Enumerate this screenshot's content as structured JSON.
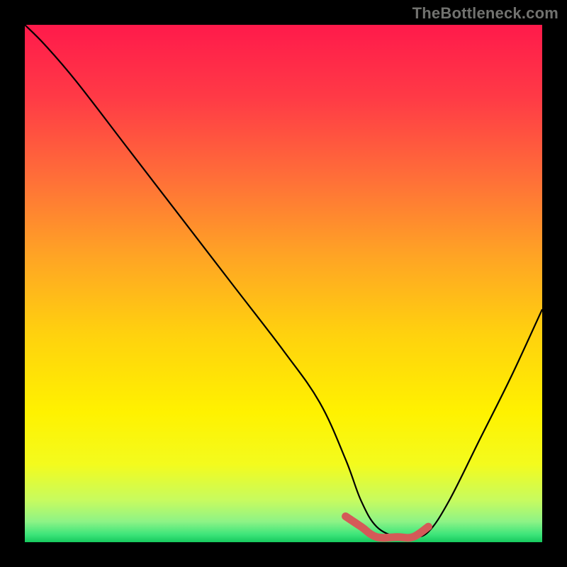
{
  "attribution": "TheBottleneck.com",
  "chart_data": {
    "type": "line",
    "title": "",
    "xlabel": "",
    "ylabel": "",
    "xlim": [
      0,
      100
    ],
    "ylim": [
      0,
      100
    ],
    "series": [
      {
        "name": "bottleneck-curve",
        "x": [
          0,
          4,
          10,
          20,
          30,
          40,
          50,
          57,
          62,
          65,
          68,
          72,
          75,
          78,
          82,
          88,
          94,
          100
        ],
        "values": [
          100,
          96,
          89,
          76,
          63,
          50,
          37,
          27,
          16,
          8,
          3,
          1,
          1,
          2,
          8,
          20,
          32,
          45
        ]
      }
    ],
    "highlight": {
      "name": "optimal-range",
      "x": [
        62,
        65,
        68,
        72,
        75,
        78
      ],
      "values": [
        5,
        3,
        1,
        1,
        1,
        3
      ]
    },
    "background_gradient": {
      "stops": [
        {
          "offset": 0.0,
          "color": "#ff1a4b"
        },
        {
          "offset": 0.14,
          "color": "#ff3a46"
        },
        {
          "offset": 0.3,
          "color": "#ff7038"
        },
        {
          "offset": 0.45,
          "color": "#ffa524"
        },
        {
          "offset": 0.6,
          "color": "#ffd20e"
        },
        {
          "offset": 0.75,
          "color": "#fff200"
        },
        {
          "offset": 0.85,
          "color": "#f3fb1e"
        },
        {
          "offset": 0.92,
          "color": "#c6fb60"
        },
        {
          "offset": 0.96,
          "color": "#8ef386"
        },
        {
          "offset": 0.985,
          "color": "#3de57a"
        },
        {
          "offset": 1.0,
          "color": "#16c95e"
        }
      ]
    }
  }
}
